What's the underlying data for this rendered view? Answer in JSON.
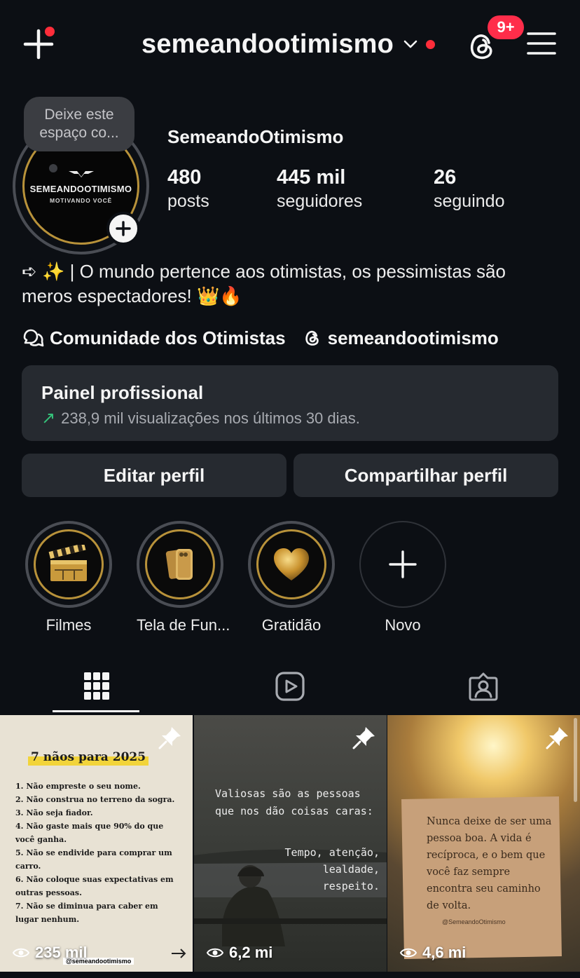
{
  "header": {
    "username": "semeandootimismo",
    "notification_badge": "9+",
    "icons": [
      "new-post-icon",
      "chevron-down-icon",
      "threads-icon",
      "menu-icon"
    ]
  },
  "profile": {
    "note": "Deixe este espaço co...",
    "avatar_brand": "SEMEANDOOTIMISMO",
    "avatar_tagline": "MOTIVANDO VOCÊ",
    "display_name": "SemeandoOtimismo",
    "stats": [
      {
        "value": "480",
        "label": "posts"
      },
      {
        "value": "445 mil",
        "label": "seguidores"
      },
      {
        "value": "26",
        "label": "seguindo"
      }
    ],
    "bio": "➪ ✨ | O mundo pertence aos otimistas, os pessimistas são meros espectadores! 👑🔥",
    "links": [
      {
        "icon": "community-icon",
        "label": "Comunidade dos Otimistas"
      },
      {
        "icon": "threads-icon",
        "label": "semeandootimismo"
      }
    ]
  },
  "dashboard": {
    "title": "Painel profissional",
    "arrow": "↗",
    "subtitle": "238,9 mil visualizações nos últimos 30 dias."
  },
  "actions": {
    "edit": "Editar perfil",
    "share": "Compartilhar perfil"
  },
  "highlights": [
    {
      "label": "Filmes",
      "icon": "clapperboard-icon"
    },
    {
      "label": "Tela de Fun...",
      "icon": "phone-icon"
    },
    {
      "label": "Gratidão",
      "icon": "heart-icon"
    },
    {
      "label": "Novo",
      "icon": "plus-icon"
    }
  ],
  "tabs": [
    "grid-icon",
    "reels-icon",
    "tagged-icon"
  ],
  "posts": [
    {
      "views": "235 mil",
      "title": "7 nãos para 2025",
      "lines": [
        "1. Não empreste o seu nome.",
        "2. Não construa no terreno da sogra.",
        "3. Não seja fiador.",
        "4. Não gaste mais que 90% do que você ganha.",
        "5. Não se endivide para comprar um carro.",
        "6. Não coloque suas expectativas em outras pessoas.",
        "7. Não se diminua para caber em lugar nenhum."
      ],
      "watermark": "@semeandootimismo"
    },
    {
      "views": "6,2 mi",
      "text_top": "Valiosas são as pessoas que nos dão coisas caras:",
      "text_bottom": "Tempo, atenção, lealdade, respeito."
    },
    {
      "views": "4,6 mi",
      "text": "Nunca deixe de ser uma pessoa boa. A vida é recíproca, e o bem que você faz sempre encontra seu caminho de volta.",
      "handle": "@SemeandoOtimismo"
    }
  ],
  "colors": {
    "background": "#0c0f14",
    "surface": "#262a30",
    "badge": "#ff2d4a",
    "gold": "#b8923a",
    "trend_green": "#35c27a"
  }
}
